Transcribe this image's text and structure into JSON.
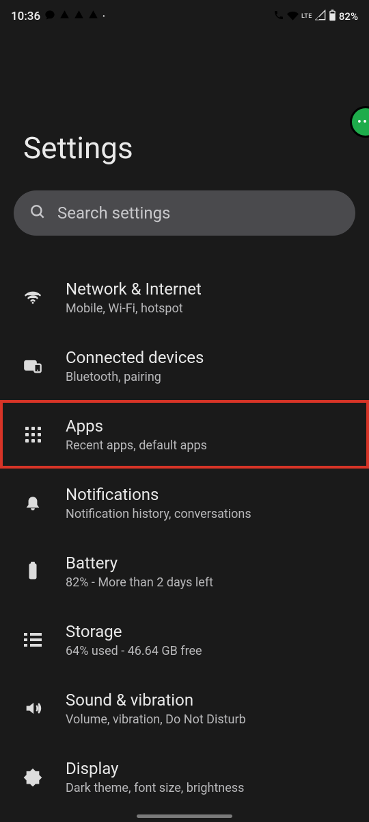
{
  "status": {
    "time": "10:36",
    "lte": "LTE",
    "battery": "82%"
  },
  "page": {
    "title": "Settings"
  },
  "search": {
    "placeholder": "Search settings"
  },
  "items": [
    {
      "title": "Network & Internet",
      "subtitle": "Mobile, Wi-Fi, hotspot"
    },
    {
      "title": "Connected devices",
      "subtitle": "Bluetooth, pairing"
    },
    {
      "title": "Apps",
      "subtitle": "Recent apps, default apps"
    },
    {
      "title": "Notifications",
      "subtitle": "Notification history, conversations"
    },
    {
      "title": "Battery",
      "subtitle": "82% - More than 2 days left"
    },
    {
      "title": "Storage",
      "subtitle": "64% used - 46.64 GB free"
    },
    {
      "title": "Sound & vibration",
      "subtitle": "Volume, vibration, Do Not Disturb"
    },
    {
      "title": "Display",
      "subtitle": "Dark theme, font size, brightness"
    }
  ]
}
